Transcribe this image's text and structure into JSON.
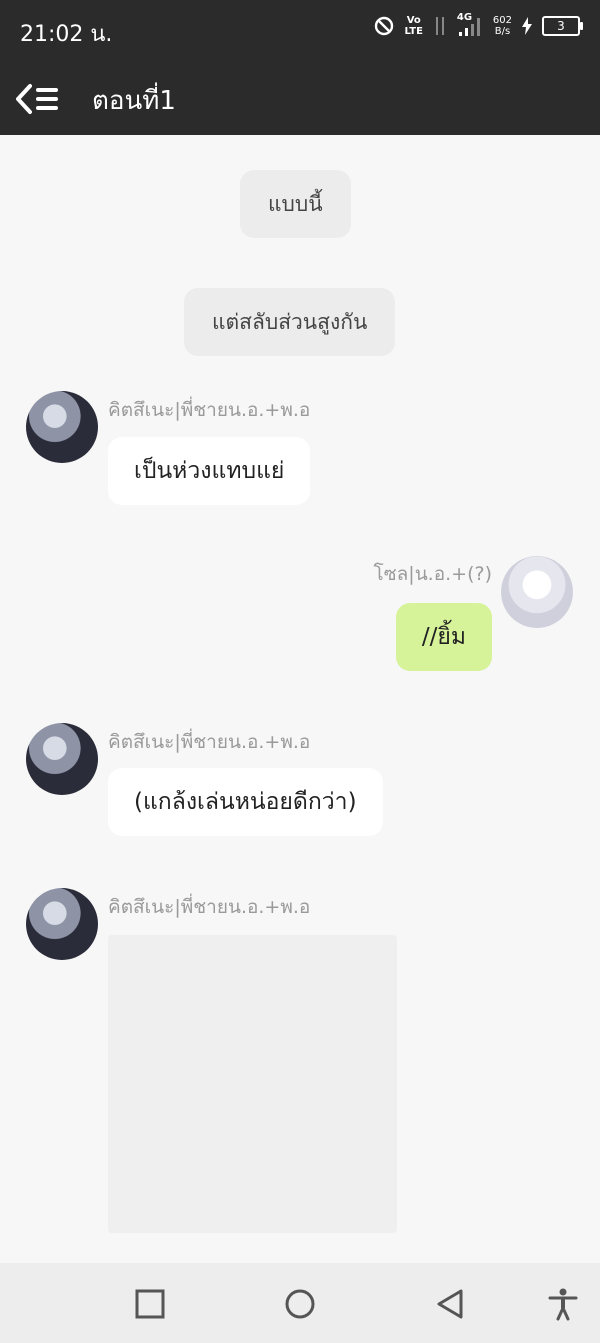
{
  "status": {
    "time": "21:02 น.",
    "volte_top": "Vo",
    "volte_bottom": "LTE",
    "network": "4G",
    "speed_top": "602",
    "speed_bottom": "B/s",
    "battery": "3"
  },
  "header": {
    "title": "ตอนที่1"
  },
  "narrations": [
    "แบบนี้",
    "แต่สลับส่วนสูงกัน"
  ],
  "messages": [
    {
      "sender": "คิตสึเนะ|พี่ชายน.อ.+พ.อ",
      "text": "เป็นห่วงแทบแย่",
      "side": "left"
    },
    {
      "sender": "โซล|น.อ.+(?)",
      "text": "//ยิ้ม",
      "side": "right"
    },
    {
      "sender": "คิตสึเนะ|พี่ชายน.อ.+พ.อ",
      "text": "(แกล้งเล่นหน่อยดีกว่า)",
      "side": "left"
    },
    {
      "sender": "คิตสึเนะ|พี่ชายน.อ.+พ.อ",
      "text": "",
      "side": "left",
      "type": "image"
    }
  ],
  "colors": {
    "header_bg": "#2b2b2b",
    "my_bubble": "#d7f39a",
    "other_bubble": "#ffffff",
    "narration_bg": "#ececec"
  },
  "icons": [
    "back-menu-icon",
    "recent-apps-icon",
    "home-icon",
    "back-icon",
    "accessibility-icon"
  ]
}
